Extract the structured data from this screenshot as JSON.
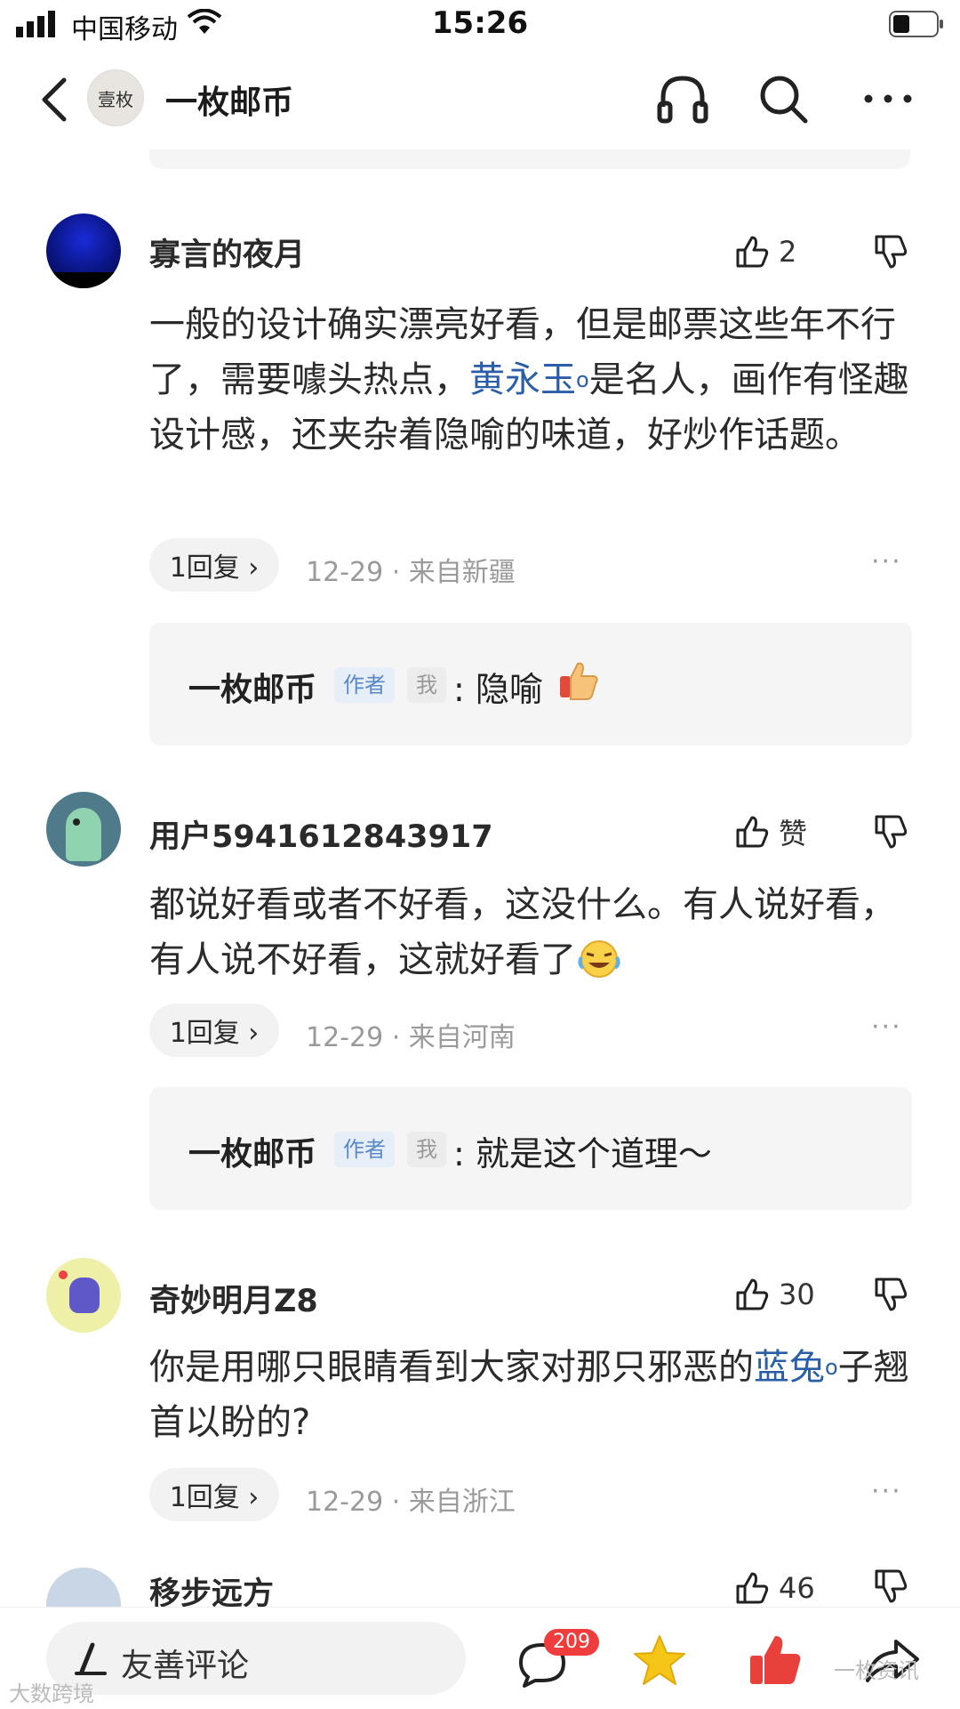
{
  "status_bar": {
    "carrier": "中国移动",
    "time": "15:26"
  },
  "header": {
    "account_avatar_text": "壹枚",
    "account_name": "一枚邮币"
  },
  "comments": [
    {
      "user": "寡言的夜月",
      "likes": "2",
      "text_before": "一般的设计确实漂亮好看，但是邮票这些年不行了，需要噱头热点，",
      "link": "黄永玉",
      "text_after": "是名人，画作有怪趣设计感，还夹杂着隐喻的味道，好炒作话题。",
      "replies_label": "1回复 ›",
      "meta": "12-29 · 来自新疆",
      "reply": {
        "name": "一枚邮币",
        "tag_author": "作者",
        "tag_me": "我",
        "text": ": 隐喻"
      }
    },
    {
      "user": "用户5941612843917",
      "likes": "赞",
      "text_before": "都说好看或者不好看，这没什么。有人说好看，有人说不好看，这就好看了",
      "replies_label": "1回复 ›",
      "meta": "12-29 · 来自河南",
      "reply": {
        "name": "一枚邮币",
        "tag_author": "作者",
        "tag_me": "我",
        "text": ": 就是这个道理～"
      }
    },
    {
      "user": "奇妙明月Z8",
      "likes": "30",
      "text_before": "你是用哪只眼睛看到大家对那只邪恶的",
      "link": "蓝兔",
      "text_after": "子翘首以盼的?",
      "replies_label": "1回复 ›",
      "meta": "12-29 · 来自浙江"
    },
    {
      "user": "移步远方",
      "likes": "46"
    }
  ],
  "bottom_bar": {
    "comment_placeholder": "友善评论",
    "comment_count": "209"
  },
  "watermarks": {
    "left": "大数跨境",
    "right": "一枚资讯"
  },
  "colors": {
    "link": "#2a5ea8",
    "badge": "#ef3c3c",
    "author_tag": "#5b88c6",
    "star": "#f5c518"
  },
  "icons": [
    "back-icon",
    "headphones-icon",
    "search-icon",
    "more-icon",
    "thumbs-up-icon",
    "thumbs-down-icon",
    "comment-icon",
    "star-icon",
    "like-icon",
    "share-icon"
  ]
}
